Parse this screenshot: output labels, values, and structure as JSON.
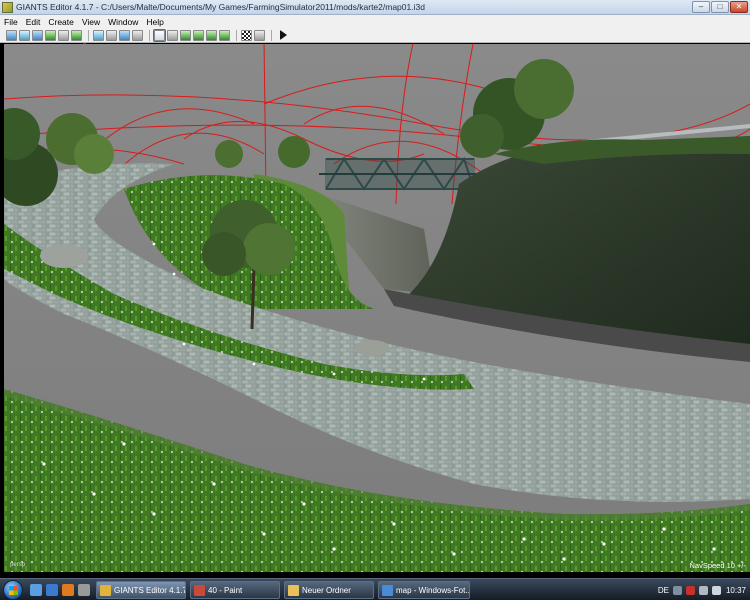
{
  "window": {
    "title": "GIANTS Editor 4.1.7 - C:/Users/Malte/Documents/My Games/FarmingSimulator2011/mods/karte2/map01.i3d",
    "minimize": "–",
    "maximize": "□",
    "close": "✕"
  },
  "menu": [
    "File",
    "Edit",
    "Create",
    "View",
    "Window",
    "Help"
  ],
  "viewport": {
    "label": "persp",
    "navspeed": "NavSpeed 10 +/-"
  },
  "taskbar": {
    "buttons": [
      {
        "label": "GIANTS Editor 4.1.7 ...",
        "icon_color": "#e0b43a"
      },
      {
        "label": "40 - Paint",
        "icon_color": "#c94a3a"
      },
      {
        "label": "Neuer Ordner",
        "icon_color": "#e8c15a"
      },
      {
        "label": "map - Windows-Fot...",
        "icon_color": "#4a8bd6"
      }
    ],
    "language": "DE",
    "clock": "10:37"
  }
}
